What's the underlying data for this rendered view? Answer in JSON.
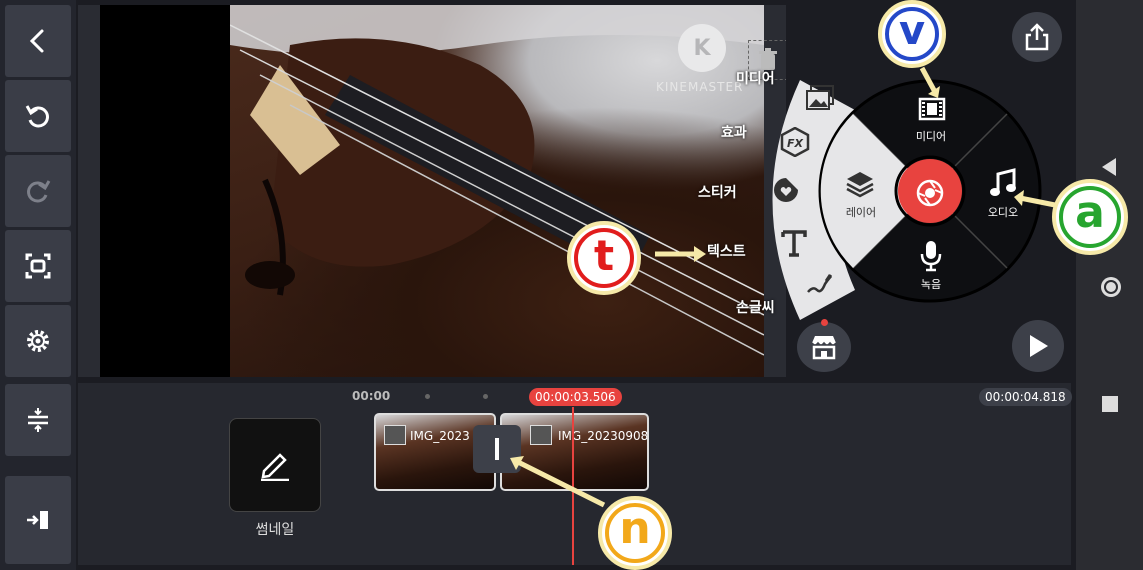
{
  "left_toolbar": {
    "items": [
      {
        "name": "back-icon"
      },
      {
        "name": "undo-icon"
      },
      {
        "name": "redo-icon"
      },
      {
        "name": "fullscreen-icon"
      },
      {
        "name": "settings-icon"
      },
      {
        "name": "adjust-track-height-icon"
      },
      {
        "name": "jump-to-icon"
      }
    ]
  },
  "preview": {
    "watermark": "KINEMASTER",
    "watermark_icon_letter": "K"
  },
  "sub_menu": {
    "items": [
      {
        "label": "미디어",
        "icon": "image-stack-icon"
      },
      {
        "label": "효과",
        "icon": "fx-icon"
      },
      {
        "label": "스티커",
        "icon": "sticker-icon"
      },
      {
        "label": "텍스트",
        "icon": "text-icon"
      },
      {
        "label": "손글씨",
        "icon": "handwriting-icon"
      }
    ]
  },
  "main_wheel": {
    "media_label": "미디어",
    "layer_label": "레이어",
    "audio_label": "오디오",
    "record_label": "녹음"
  },
  "timeline": {
    "start_time": "00:00",
    "current_time": "00:00:03.506",
    "total_time": "00:00:04.818",
    "clips": [
      {
        "label": "IMG_2023"
      },
      {
        "label": "IMG_20230908"
      }
    ],
    "thumbnail_label": "썸네일"
  },
  "annotations": {
    "v": "v",
    "a": "a",
    "t": "t",
    "n": "n"
  },
  "colors": {
    "accent_red": "#e8433f",
    "annotation_yellow": "#f6e9a8",
    "annotation_v": "#2448c8",
    "annotation_a": "#27a52f",
    "annotation_t": "#e11d1d",
    "annotation_n": "#f2a81a"
  }
}
